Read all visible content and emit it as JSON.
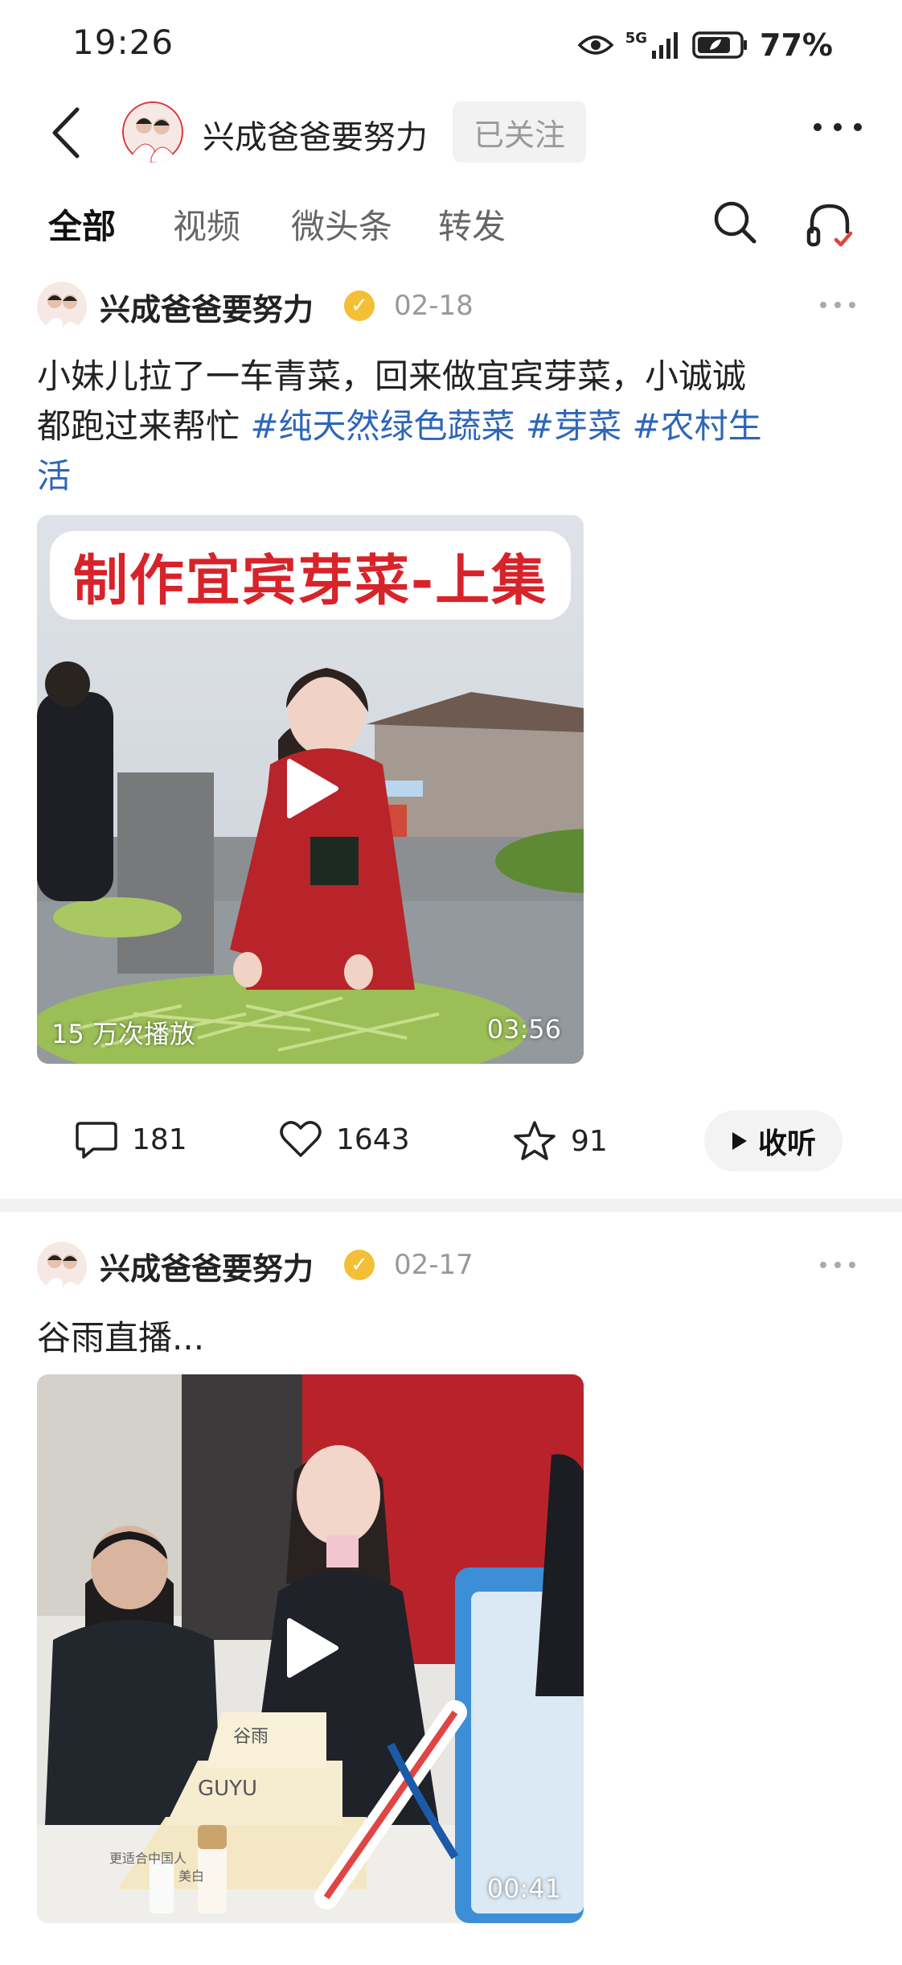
{
  "status_bar": {
    "time": "19:26",
    "network": "5G",
    "battery": "77%"
  },
  "header": {
    "account_name": "兴成爸爸要努力",
    "follow_label": "已关注"
  },
  "tabs": [
    {
      "label": "全部",
      "active": true
    },
    {
      "label": "视频",
      "active": false
    },
    {
      "label": "微头条",
      "active": false
    },
    {
      "label": "转发",
      "active": false
    }
  ],
  "posts": [
    {
      "author": "兴成爸爸要努力",
      "date": "02-18",
      "text_line1": "小妹儿拉了一车青菜，回来做宜宾芽菜，小诚诚",
      "text_line2_plain": "都跑过来帮忙 ",
      "tag1": "#纯天然绿色蔬菜",
      "tag2": "#芽菜",
      "tag3": "#农村生",
      "tag3_cont": "活",
      "video": {
        "banner": "制作宜宾芽菜-上集",
        "plays": "15 万次播放",
        "duration": "03:56"
      },
      "actions": {
        "comments": "181",
        "likes": "1643",
        "favorites": "91",
        "listen_label": "收听"
      }
    },
    {
      "author": "兴成爸爸要努力",
      "date": "02-17",
      "text": "谷雨直播...",
      "video": {
        "duration": "00:41",
        "product_text1": "谷雨",
        "product_text2": "GUYU",
        "product_text3": "更适合中国人",
        "product_text4": "美白"
      }
    }
  ],
  "colors": {
    "hashtag": "#2e66b8",
    "verified_badge": "#f2bf36"
  }
}
